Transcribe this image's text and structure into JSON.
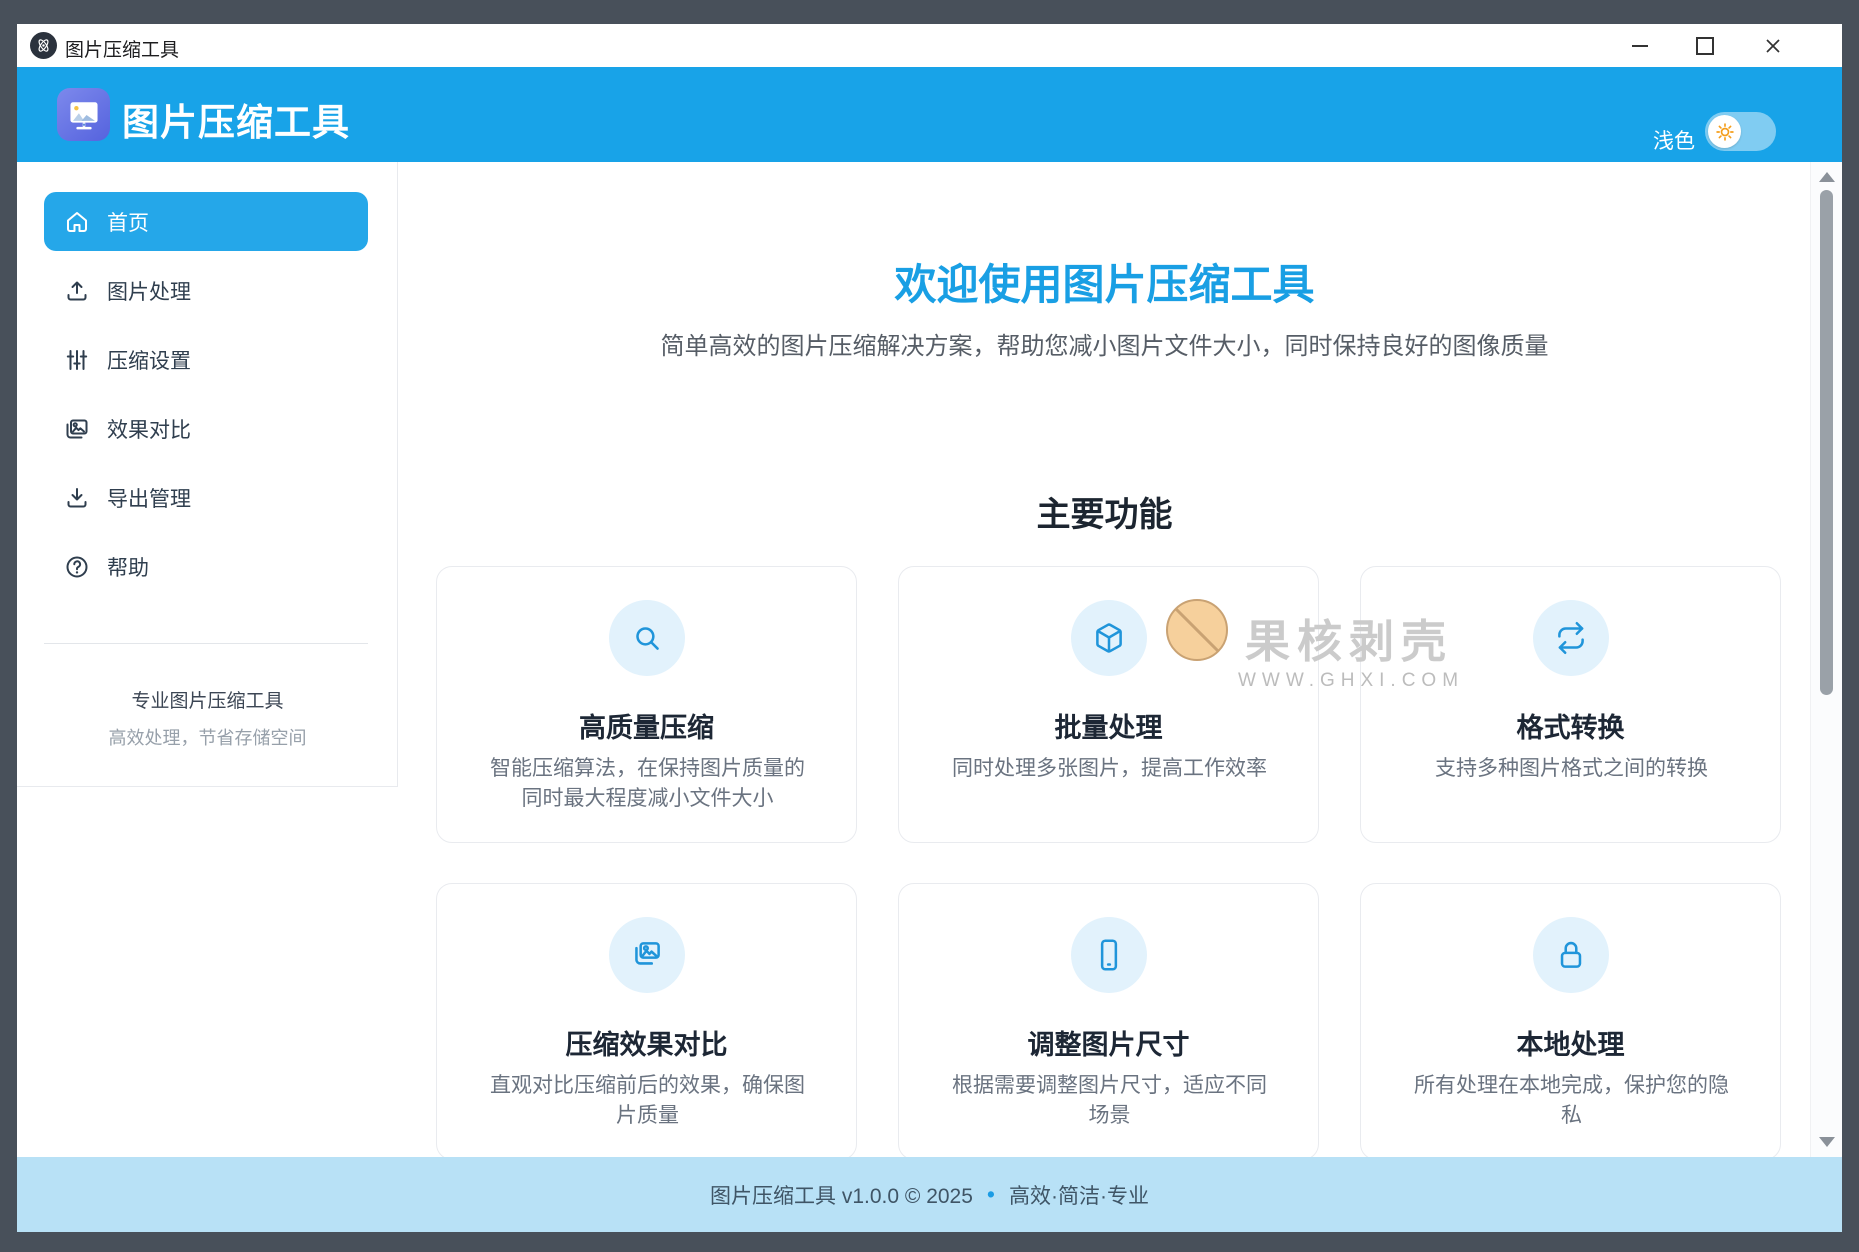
{
  "window": {
    "title": "图片压缩工具"
  },
  "header": {
    "app_title": "图片压缩工具",
    "theme_label": "浅色"
  },
  "sidebar": {
    "items": [
      {
        "label": "首页",
        "icon": "home",
        "active": true
      },
      {
        "label": "图片处理",
        "icon": "upload",
        "active": false
      },
      {
        "label": "压缩设置",
        "icon": "sliders",
        "active": false
      },
      {
        "label": "效果对比",
        "icon": "compare",
        "active": false
      },
      {
        "label": "导出管理",
        "icon": "download",
        "active": false
      },
      {
        "label": "帮助",
        "icon": "help",
        "active": false
      }
    ],
    "footer_line1": "专业图片压缩工具",
    "footer_line2": "高效处理，节省存储空间"
  },
  "main": {
    "welcome_title": "欢迎使用图片压缩工具",
    "welcome_subtitle": "简单高效的图片压缩解决方案，帮助您减小图片文件大小，同时保持良好的图像质量",
    "section_title": "主要功能",
    "features": [
      {
        "title": "高质量压缩",
        "desc": "智能压缩算法，在保持图片质量的同时最大程度减小文件大小",
        "icon": "search"
      },
      {
        "title": "批量处理",
        "desc": "同时处理多张图片，提高工作效率",
        "icon": "cube"
      },
      {
        "title": "格式转换",
        "desc": "支持多种图片格式之间的转换",
        "icon": "swap"
      },
      {
        "title": "压缩效果对比",
        "desc": "直观对比压缩前后的效果，确保图片质量",
        "icon": "images"
      },
      {
        "title": "调整图片尺寸",
        "desc": "根据需要调整图片尺寸，适应不同场景",
        "icon": "phone"
      },
      {
        "title": "本地处理",
        "desc": "所有处理在本地完成，保护您的隐私",
        "icon": "lock"
      }
    ]
  },
  "watermark": {
    "text": "果核剥壳",
    "url": "WWW.GHXI.COM"
  },
  "footer": {
    "left": "图片压缩工具 v1.0.0 © 2025",
    "bullet": "•",
    "right": "高效·简洁·专业"
  },
  "colors": {
    "header_blue": "#18a3e8",
    "accent_blue": "#2095da",
    "title_blue": "#199fe4",
    "footer_bg": "#b8e1f6",
    "active_nav": "#25a7e9"
  }
}
